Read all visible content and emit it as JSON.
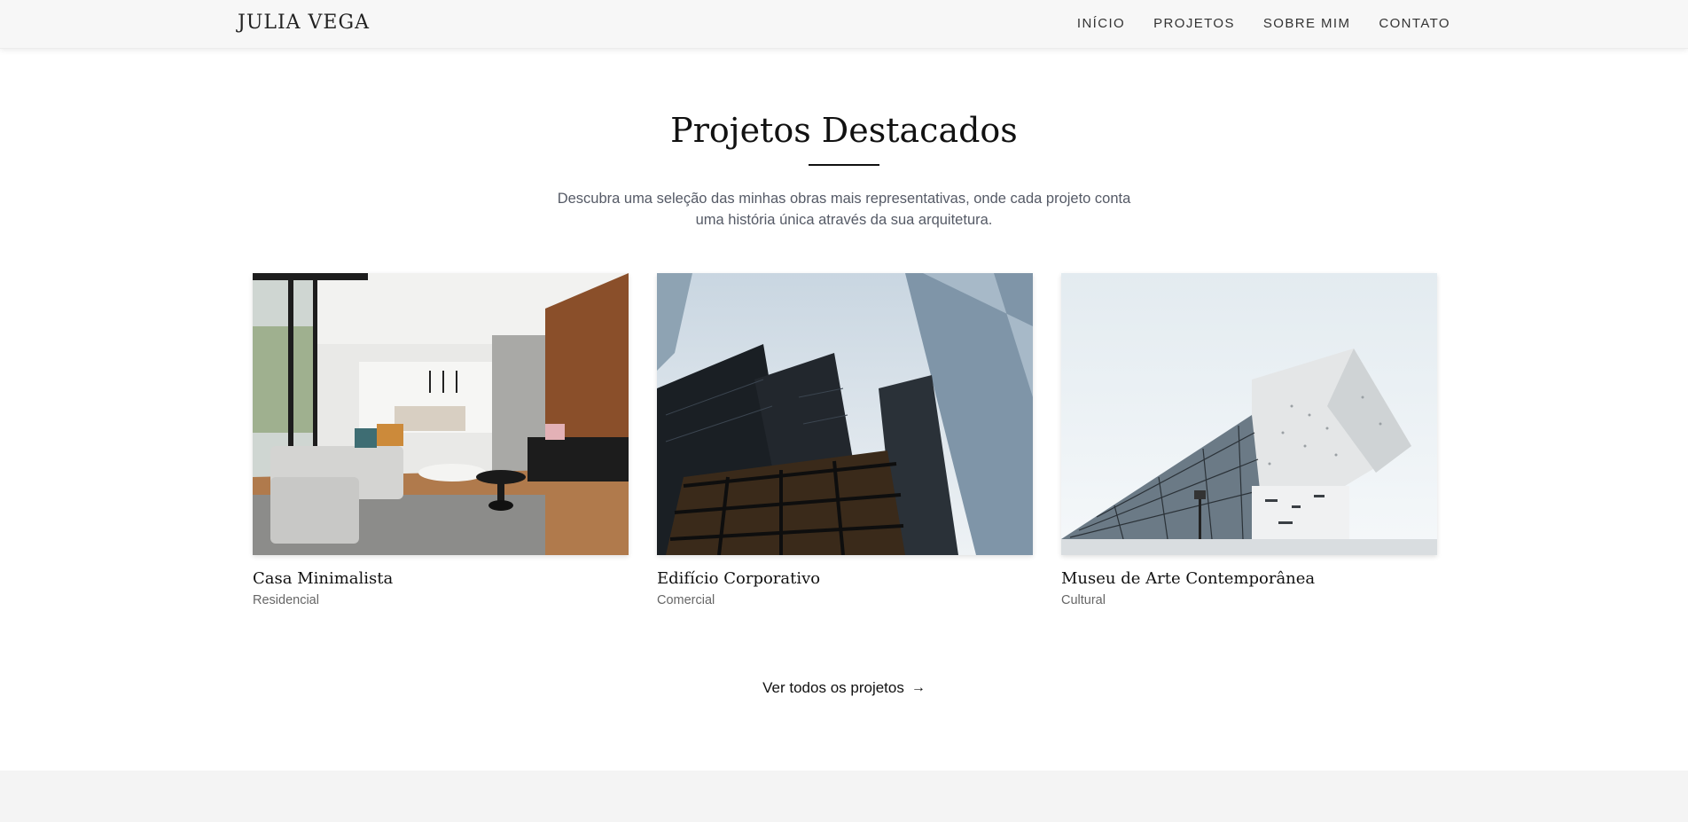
{
  "header": {
    "logo": "JULIA VEGA",
    "nav": [
      {
        "label": "INÍCIO"
      },
      {
        "label": "PROJETOS"
      },
      {
        "label": "SOBRE MIM"
      },
      {
        "label": "CONTATO"
      }
    ]
  },
  "featured": {
    "title": "Projetos Destacados",
    "description_line1": "Descubra uma seleção das minhas obras mais representativas, onde cada projeto conta",
    "description_line2": "uma história única através da sua arquitetura.",
    "projects": [
      {
        "title": "Casa Minimalista",
        "category": "Residencial",
        "image": "living-room-photo"
      },
      {
        "title": "Edifício Corporativo",
        "category": "Comercial",
        "image": "skyscrapers-photo"
      },
      {
        "title": "Museu de Arte Contemporânea",
        "category": "Cultural",
        "image": "museum-photo"
      }
    ],
    "cta_label": "Ver todos os projetos",
    "cta_icon": "arrow-right-icon"
  },
  "colors": {
    "text": "#111111",
    "muted": "#555a66",
    "header_bg": "#f7f7f7",
    "footer_bg": "#f4f4f4"
  }
}
